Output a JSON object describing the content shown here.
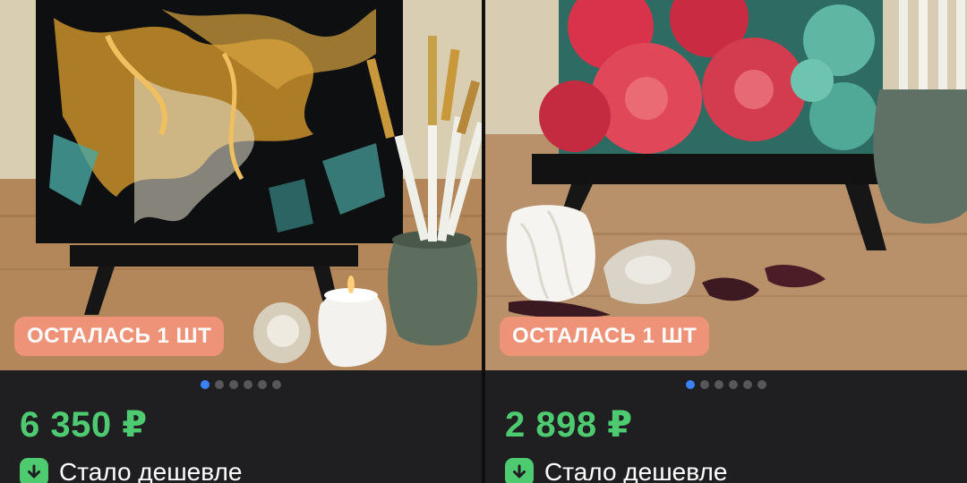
{
  "products": [
    {
      "badge": "ОСТАЛАСЬ 1 ШТ",
      "price": "6 350 ₽",
      "price_drop_label": "Стало дешевле",
      "carousel": {
        "total": 6,
        "active_index": 0
      },
      "image_icon": "owl-painting-photo"
    },
    {
      "badge": "ОСТАЛАСЬ 1 ШТ",
      "price": "2 898 ₽",
      "price_drop_label": "Стало дешевле",
      "carousel": {
        "total": 6,
        "active_index": 0
      },
      "image_icon": "roses-painting-photo"
    }
  ],
  "colors": {
    "badge_bg": "#ef9378",
    "price_green": "#4ecb71",
    "dot_active": "#3b82f6",
    "dot_inactive": "#57575c",
    "card_bg": "#1f1f21"
  },
  "icons": {
    "price_drop": "arrow-down-icon"
  }
}
